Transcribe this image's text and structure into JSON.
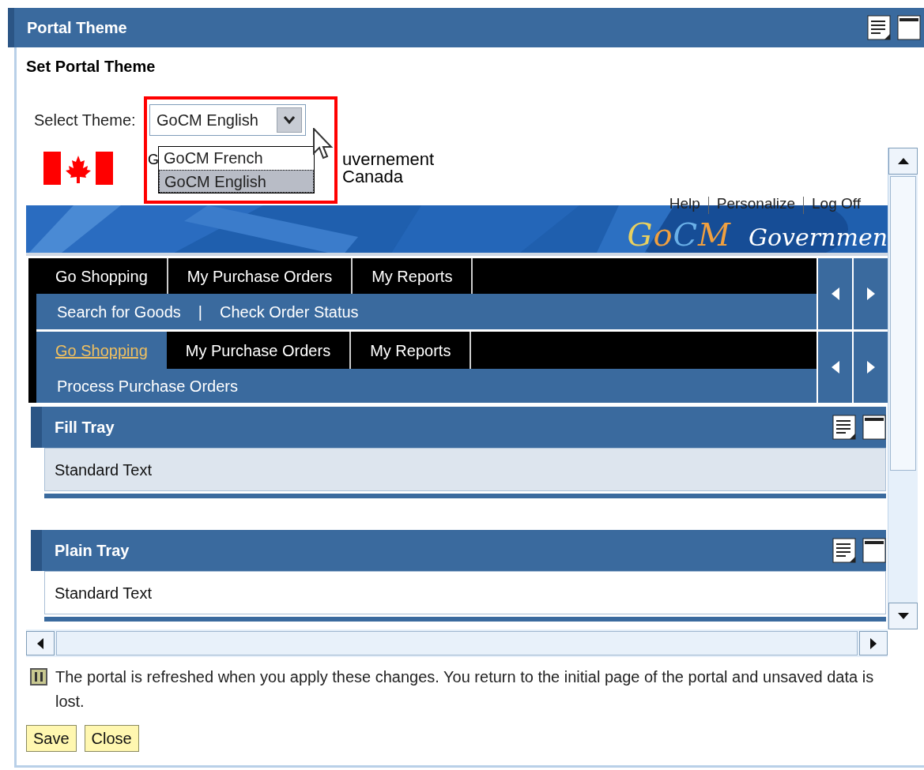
{
  "panel": {
    "title": "Portal Theme"
  },
  "section_title": "Set Portal Theme",
  "theme_select": {
    "label": "Select Theme:",
    "value": "GoCM English",
    "expanded": true,
    "options": [
      {
        "label": "GoCM French",
        "selected": false
      },
      {
        "label": "GoCM English",
        "selected": true
      }
    ]
  },
  "frame": {
    "logo_text": [
      {
        "left": "G",
        "right": "uvernement"
      },
      {
        "right": "Canada"
      }
    ],
    "header_links": [
      "Help",
      "Personalize",
      "Log Off"
    ],
    "brand": "GoCM",
    "brand_tagline": "Governmen",
    "nav_rows": [
      {
        "tabs": [
          {
            "label": "Go Shopping",
            "selected": false
          },
          {
            "label": "My Purchase Orders",
            "selected": false
          },
          {
            "label": "My Reports",
            "selected": false
          }
        ],
        "links": [
          "Search for Goods",
          "Check Order Status"
        ],
        "separator": "|"
      },
      {
        "tabs": [
          {
            "label": "Go Shopping",
            "selected": true
          },
          {
            "label": "My Purchase Orders",
            "selected": false
          },
          {
            "label": "My Reports",
            "selected": false
          }
        ],
        "links": [
          "Process Purchase Orders"
        ]
      }
    ],
    "trays": [
      {
        "title": "Fill Tray",
        "text": "Standard Text",
        "kind": "fill"
      },
      {
        "title": "Plain Tray",
        "text": "Standard Text",
        "kind": "plain"
      }
    ]
  },
  "notice": "The portal is refreshed when you apply these changes. You return to the initial page of the portal and unsaved data is lost.",
  "buttons": [
    "Save",
    "Close"
  ]
}
